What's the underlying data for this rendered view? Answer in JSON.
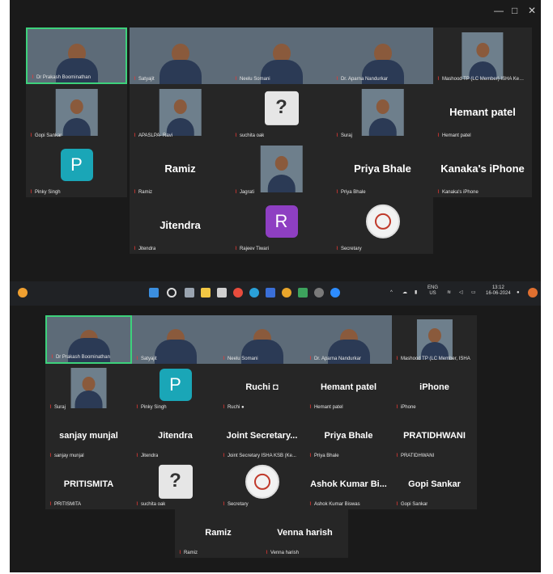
{
  "top_meeting": {
    "window_controls": {
      "minimize": "—",
      "maximize": "□",
      "close": "✕"
    },
    "participants": [
      {
        "id": "t1",
        "label": "Dr Prakash Boominathan",
        "kind": "video",
        "active": true
      },
      {
        "id": "t2",
        "label": "Satyajit",
        "kind": "video"
      },
      {
        "id": "t3",
        "label": "Neelu Somani",
        "kind": "video"
      },
      {
        "id": "t4",
        "label": "Dr. Aparna Nandurkar",
        "kind": "video"
      },
      {
        "id": "t5",
        "label": "Mashood TP (LC Member) ISHA Keral",
        "kind": "video-inset"
      },
      {
        "id": "t6",
        "label": "Gopi Sankar",
        "kind": "video-inset"
      },
      {
        "id": "t7",
        "label": "APASLPA- Ravi",
        "kind": "video-inset"
      },
      {
        "id": "t8",
        "label": "suchita oak",
        "kind": "logo-ear",
        "logo_text": "?"
      },
      {
        "id": "t9",
        "label": "Suraj",
        "kind": "video-inset"
      },
      {
        "id": "t10",
        "label": "Hemant patel",
        "display": "Hemant patel",
        "kind": "name"
      },
      {
        "id": "t11",
        "label": "Pinky Singh",
        "kind": "avatar",
        "letter": "P",
        "color": "#1aa6b7"
      },
      {
        "id": "t12",
        "label": "Ramiz",
        "display": "Ramiz",
        "kind": "name"
      },
      {
        "id": "t13",
        "label": "Jagrati",
        "kind": "video-inset"
      },
      {
        "id": "t14",
        "label": "Priya Bhale",
        "display": "Priya Bhale",
        "kind": "name"
      },
      {
        "id": "t15",
        "label": "Kanaka's iPhone",
        "display": "Kanaka's iPhone",
        "kind": "name"
      },
      {
        "id": "t16",
        "label": "Jitendra",
        "display": "Jitendra",
        "kind": "name"
      },
      {
        "id": "t17",
        "label": "Rajeev Tiwari",
        "kind": "avatar",
        "letter": "R",
        "color": "#8e3fc2"
      },
      {
        "id": "t18",
        "label": "Secretary",
        "kind": "logo"
      }
    ]
  },
  "taskbar": {
    "language": "ENG",
    "region": "US",
    "time": "13:12",
    "date": "16-06-2024"
  },
  "bottom_meeting": {
    "participants": [
      {
        "id": "b1",
        "label": "Dr Prakash Boominathan",
        "kind": "video",
        "active": true
      },
      {
        "id": "b2",
        "label": "Satyajit",
        "kind": "video"
      },
      {
        "id": "b3",
        "label": "Neelu Somani",
        "kind": "video"
      },
      {
        "id": "b4",
        "label": "Dr. Aparna Nandurkar",
        "kind": "video"
      },
      {
        "id": "b5",
        "label": "Mashood TP (LC Member, ISHA",
        "kind": "video-inset"
      },
      {
        "id": "b6",
        "label": "Suraj",
        "kind": "video-inset"
      },
      {
        "id": "b7",
        "label": "Pinky Singh",
        "kind": "avatar",
        "letter": "P",
        "color": "#1aa6b7"
      },
      {
        "id": "b8",
        "label": "Ruchi ●",
        "display": "Ruchi ◘",
        "kind": "name"
      },
      {
        "id": "b9",
        "label": "Hemant patel",
        "display": "Hemant patel",
        "kind": "name"
      },
      {
        "id": "b10",
        "label": "iPhone",
        "display": "iPhone",
        "kind": "name"
      },
      {
        "id": "b11",
        "label": "sanjay munjal",
        "display": "sanjay munjal",
        "kind": "name"
      },
      {
        "id": "b12",
        "label": "Jitendra",
        "display": "Jitendra",
        "kind": "name"
      },
      {
        "id": "b13",
        "label": "Joint Secretary ISHA KSB (Ke...",
        "display": "Joint Secretary...",
        "kind": "name"
      },
      {
        "id": "b14",
        "label": "Priya Bhale",
        "display": "Priya Bhale",
        "kind": "name"
      },
      {
        "id": "b15",
        "label": "PRATIDHWANI",
        "display": "PRATIDHWANI",
        "kind": "name"
      },
      {
        "id": "b16",
        "label": "PRITISMITA",
        "display": "PRITISMITA",
        "kind": "name"
      },
      {
        "id": "b17",
        "label": "suchita oak",
        "kind": "logo-ear",
        "logo_text": "?"
      },
      {
        "id": "b18",
        "label": "Secretary",
        "kind": "logo"
      },
      {
        "id": "b19",
        "label": "Ashok Kumar Biswas",
        "display": "Ashok Kumar Bi...",
        "kind": "name"
      },
      {
        "id": "b20",
        "label": "Gopi Sankar",
        "display": "Gopi Sankar",
        "kind": "name"
      },
      {
        "id": "b21",
        "label": "Ramiz",
        "display": "Ramiz",
        "kind": "name"
      },
      {
        "id": "b22",
        "label": "Venna harish",
        "display": "Venna harish",
        "kind": "name"
      }
    ]
  }
}
